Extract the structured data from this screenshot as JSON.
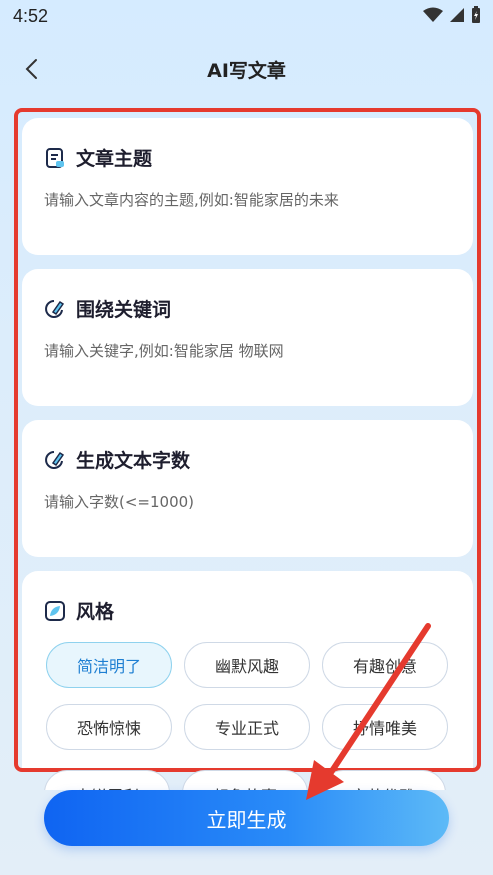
{
  "status": {
    "time": "4:52"
  },
  "header": {
    "title": "AI写文章"
  },
  "topic": {
    "title": "文章主题",
    "placeholder": "请输入文章内容的主题,例如:智能家居的未来"
  },
  "keywords": {
    "title": "围绕关键词",
    "placeholder": "请输入关键字,例如:智能家居 物联网"
  },
  "wordcount": {
    "title": "生成文本字数",
    "placeholder": "请输入字数(<=1000)"
  },
  "style": {
    "title": "风格",
    "chips": [
      "简洁明了",
      "幽默风趣",
      "有趣创意",
      "恐怖惊悚",
      "专业正式",
      "抒情唯美"
    ],
    "selected": "简洁明了",
    "peek_chips": [
      "尖锐犀利",
      "想象故事",
      "文艺优雅"
    ]
  },
  "generate": {
    "label": "立即生成"
  },
  "colors": {
    "accent": "#1e7fd2",
    "annotation": "#e53a2e"
  }
}
